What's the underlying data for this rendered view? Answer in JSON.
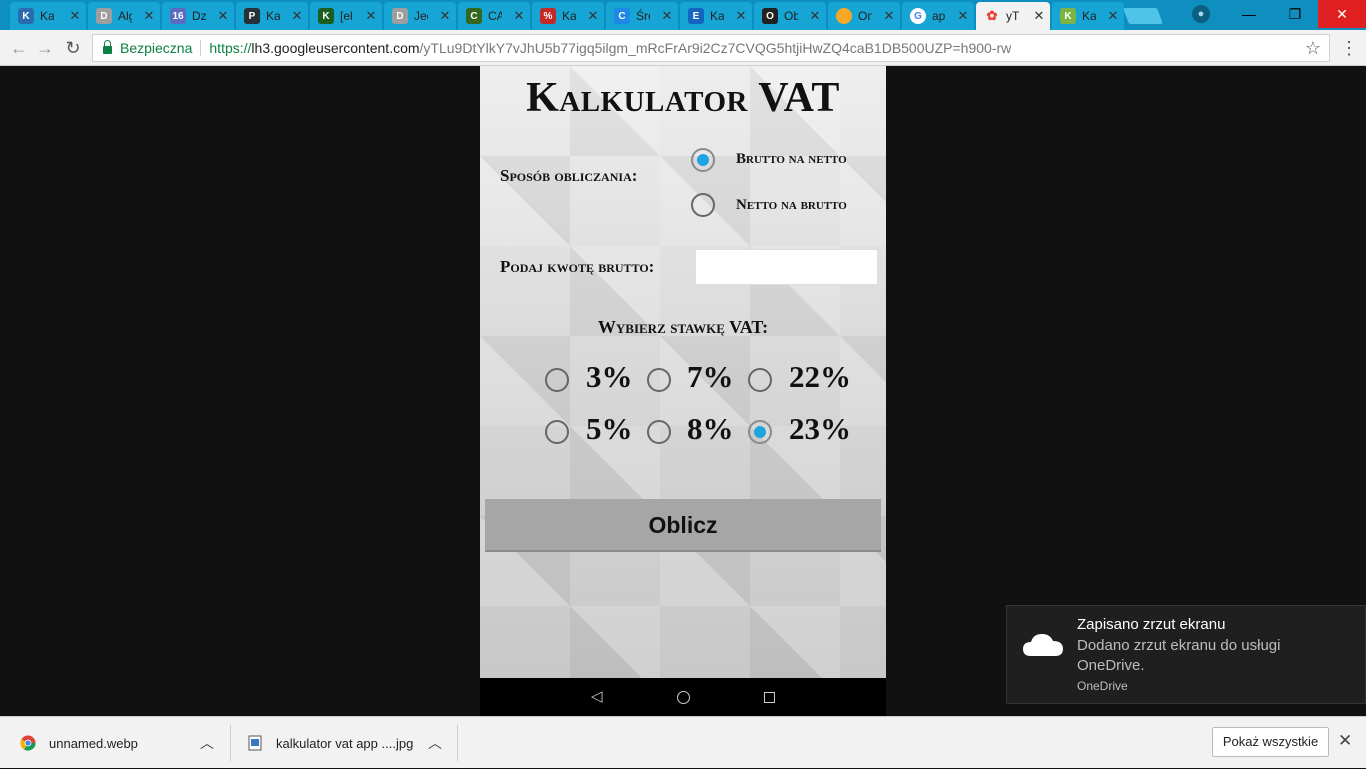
{
  "tabs": [
    {
      "label": "Ka",
      "icon": "kalkulator-favicon",
      "color": "#2b6cb0",
      "glyph": "K"
    },
    {
      "label": "Alg",
      "icon": "document-favicon",
      "color": "#9e9e9e",
      "glyph": "D"
    },
    {
      "label": "Dz",
      "icon": "calendar-favicon",
      "color": "#5c6bc0",
      "glyph": "16"
    },
    {
      "label": "Ka",
      "icon": "pz-favicon",
      "color": "#263238",
      "glyph": "P"
    },
    {
      "label": "[el",
      "icon": "k-favicon",
      "color": "#1b5e20",
      "glyph": "K"
    },
    {
      "label": "Jed",
      "icon": "document-favicon",
      "color": "#9e9e9e",
      "glyph": "D"
    },
    {
      "label": "CA",
      "icon": "c-favicon",
      "color": "#33691e",
      "glyph": "C"
    },
    {
      "label": "Ka",
      "icon": "percent-favicon",
      "color": "#c62828",
      "glyph": "%"
    },
    {
      "label": "Śre",
      "icon": "c-blue-favicon",
      "color": "#1e88e5",
      "glyph": "C"
    },
    {
      "label": "Ka",
      "icon": "calculator-favicon",
      "color": "#1565c0",
      "glyph": "E"
    },
    {
      "label": "Ob",
      "icon": "graduation-favicon",
      "color": "#212121",
      "glyph": "O"
    },
    {
      "label": "On",
      "icon": "coin-favicon",
      "color": "#f9a825",
      "glyph": "●"
    },
    {
      "label": "ap",
      "icon": "google-favicon",
      "color": "#4285f4",
      "glyph": "G"
    },
    {
      "label": "yTL",
      "icon": "photos-favicon",
      "color": "#ea4335",
      "glyph": "✿",
      "active": true
    },
    {
      "label": "Ka",
      "icon": "leaf-favicon",
      "color": "#7cb342",
      "glyph": "K"
    }
  ],
  "browser": {
    "secure_label": "Bezpieczna",
    "url_scheme": "https://",
    "url_host": "lh3.googleusercontent.com",
    "url_rest": "/yTLu9DtYlkY7vJhU5b77igq5ilgm_mRcFrAr9i2Cz7CVQG5htjiHwZQ4caB1DB500UZP=h900-rw"
  },
  "app": {
    "title": "Kalkulator VAT",
    "mode_label": "Sposób obliczania:",
    "modes": [
      {
        "label": "Brutto na netto",
        "selected": true
      },
      {
        "label": "Netto na brutto",
        "selected": false
      }
    ],
    "amount_label": "Podaj kwotę brutto:",
    "amount_value": "",
    "rate_label": "Wybierz stawkę VAT:",
    "rates": [
      {
        "label": "3%",
        "selected": false
      },
      {
        "label": "7%",
        "selected": false
      },
      {
        "label": "22%",
        "selected": false
      },
      {
        "label": "5%",
        "selected": false
      },
      {
        "label": "8%",
        "selected": false
      },
      {
        "label": "23%",
        "selected": true
      }
    ],
    "calc_button": "Oblicz",
    "accent_color": "#1ea4e0"
  },
  "toast": {
    "title": "Zapisano zrzut ekranu",
    "body": "Dodano zrzut ekranu do usługi OneDrive.",
    "source": "OneDrive"
  },
  "downloads": {
    "items": [
      {
        "name": "unnamed.webp",
        "icon": "chrome-icon"
      },
      {
        "name": "kalkulator vat app ....jpg",
        "icon": "image-file-icon"
      }
    ],
    "show_all": "Pokaż wszystkie"
  }
}
